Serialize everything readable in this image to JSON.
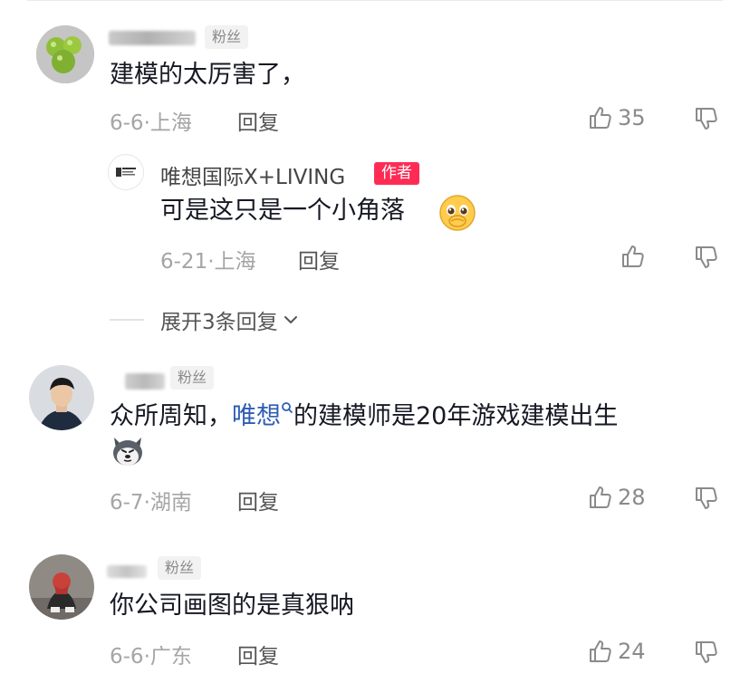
{
  "comments": [
    {
      "badge": "粉丝",
      "text": "建模的太厉害了，",
      "date_location": "6-6·上海",
      "reply_label": "回复",
      "likes": "35",
      "replies": [
        {
          "author": "唯想国际X+LIVING",
          "author_badge": "作者",
          "text": "可是这只是一个小角落",
          "date_location": "6-21·上海",
          "reply_label": "回复"
        }
      ],
      "expand_label": "展开3条回复"
    },
    {
      "badge": "粉丝",
      "text_before": "众所周知，",
      "mention": "唯想",
      "text_after": "的建模师是20年游戏建模出生",
      "date_location": "6-7·湖南",
      "reply_label": "回复",
      "likes": "28"
    },
    {
      "badge": "粉丝",
      "text": "你公司画图的是真狠呐",
      "date_location": "6-6·广东",
      "reply_label": "回复",
      "likes": "24"
    }
  ],
  "icons": {
    "like": "thumbs-up-icon",
    "dislike": "thumbs-down-icon",
    "expand": "chevron-down-icon",
    "mention_search": "search-icon",
    "emoji_reply": "pleading-face-emoji",
    "emoji_comment": "husky-dog-emoji"
  },
  "colors": {
    "author_badge": "#fe2c55",
    "mention": "#2e5db4",
    "meta_text": "#a5a5a5"
  }
}
